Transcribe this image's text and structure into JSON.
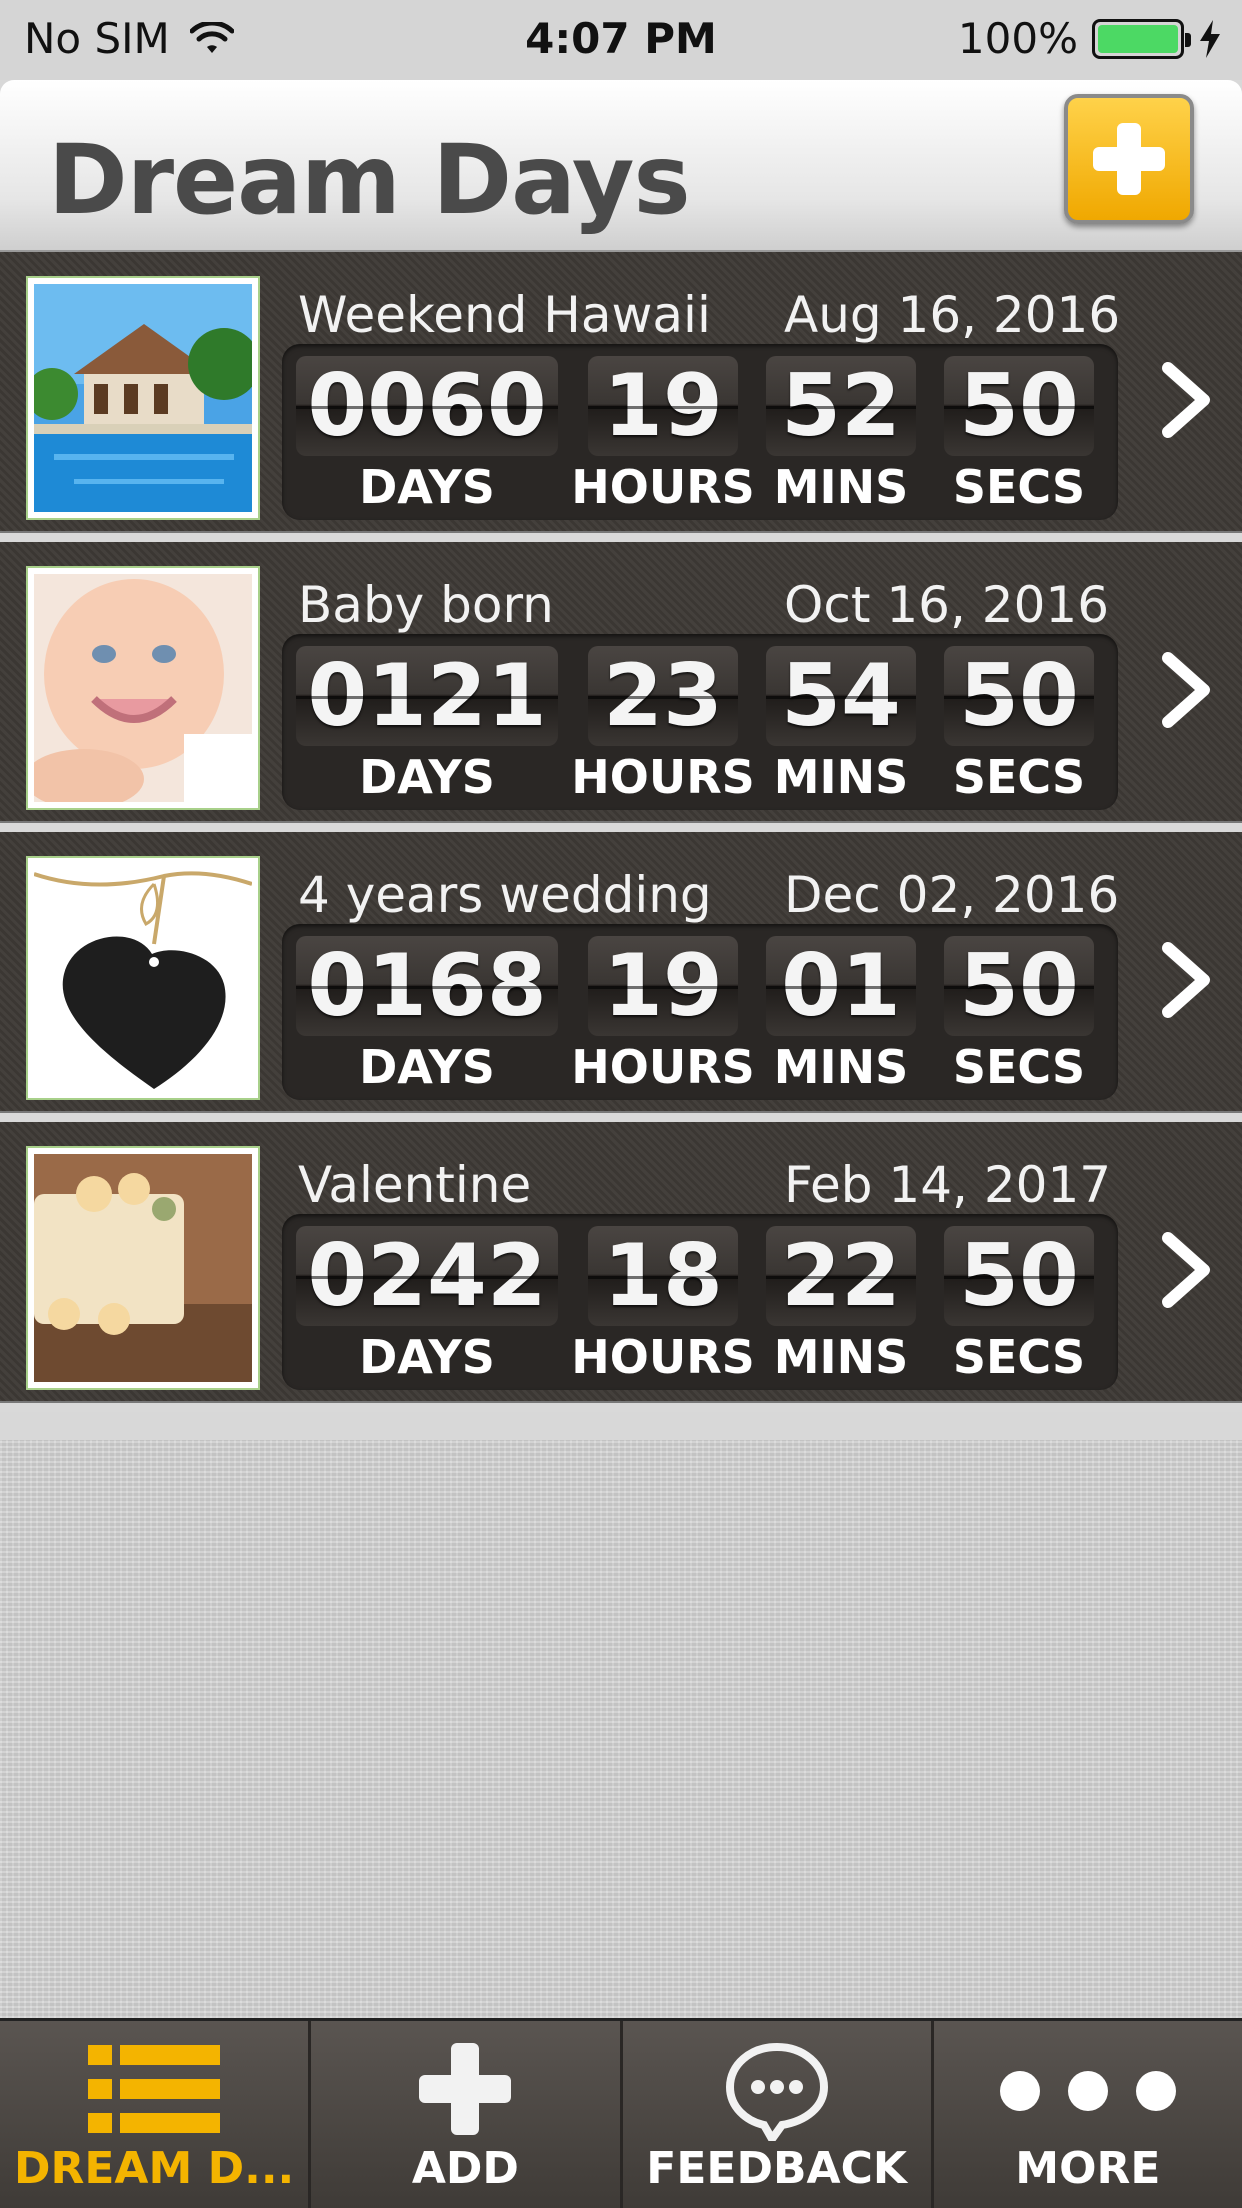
{
  "status_bar": {
    "carrier": "No SIM",
    "time": "4:07 PM",
    "battery": "100%"
  },
  "header": {
    "title": "Dream Days"
  },
  "events": [
    {
      "name": "Weekend Hawaii",
      "date": "Aug 16, 2016",
      "days": "0060",
      "hours": "19",
      "mins": "52",
      "secs": "50",
      "thumb": "resort-pool-photo"
    },
    {
      "name": "Baby born",
      "date": "Oct 16, 2016",
      "days": "0121",
      "hours": "23",
      "mins": "54",
      "secs": "50",
      "thumb": "baby-photo"
    },
    {
      "name": "4 years wedding",
      "date": "Dec 02, 2016",
      "days": "0168",
      "hours": "19",
      "mins": "01",
      "secs": "50",
      "thumb": "heart-tag-photo"
    },
    {
      "name": "Valentine",
      "date": "Feb 14, 2017",
      "days": "0242",
      "hours": "18",
      "mins": "22",
      "secs": "50",
      "thumb": "love-card-photo"
    }
  ],
  "units": {
    "days": "DAYS",
    "hours": "HOURS",
    "mins": "MINS",
    "secs": "SECS"
  },
  "tabbar": {
    "tabs": [
      {
        "label": "DREAM D...",
        "icon": "list-icon",
        "active": true
      },
      {
        "label": "ADD",
        "icon": "plus-icon",
        "active": false
      },
      {
        "label": "FEEDBACK",
        "icon": "chat-bubble-icon",
        "active": false
      },
      {
        "label": "MORE",
        "icon": "more-dots-icon",
        "active": false
      }
    ]
  },
  "colors": {
    "accent": "#f4b400",
    "row_bg": "#3e3a36",
    "battery": "#4cd964"
  }
}
